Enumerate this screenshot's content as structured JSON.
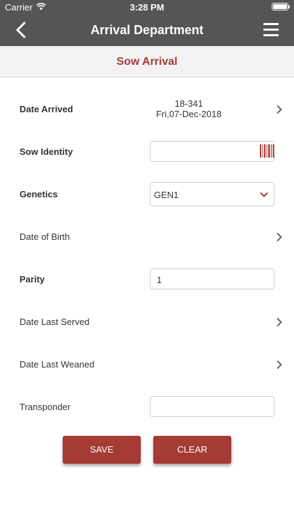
{
  "status_bar": {
    "carrier": "Carrier",
    "time": "3:28 PM"
  },
  "nav": {
    "title": "Arrival Department"
  },
  "subheader": {
    "title": "Sow Arrival"
  },
  "form": {
    "date_arrived": {
      "label": "Date Arrived",
      "code": "18-341",
      "date": "Fri,07-Dec-2018"
    },
    "sow_identity": {
      "label": "Sow Identity",
      "value": ""
    },
    "genetics": {
      "label": "Genetics",
      "selected": "GEN1"
    },
    "date_of_birth": {
      "label": "Date of Birth"
    },
    "parity": {
      "label": "Parity",
      "value": "1"
    },
    "date_last_served": {
      "label": "Date Last Served"
    },
    "date_last_weaned": {
      "label": "Date Last Weaned"
    },
    "transponder": {
      "label": "Transponder",
      "value": ""
    }
  },
  "buttons": {
    "save": "SAVE",
    "clear": "CLEAR"
  },
  "colors": {
    "accent": "#a43b35",
    "bar": "#555555"
  },
  "icons": [
    "wifi-icon",
    "battery-icon",
    "back-icon",
    "menu-icon",
    "chevron-right-icon",
    "barcode-icon",
    "chevron-down-icon"
  ]
}
